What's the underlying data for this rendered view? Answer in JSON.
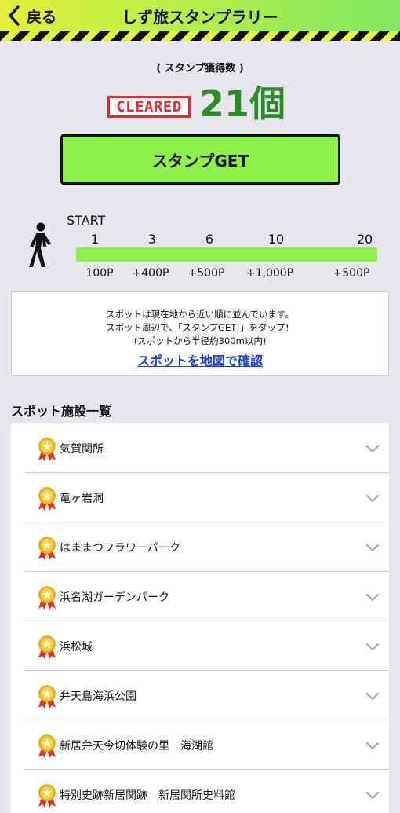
{
  "header": {
    "back_label": "戻る",
    "title": "しず旅スタンプラリー"
  },
  "stamp_count": {
    "caption": "( スタンプ獲得数 )",
    "badge": "CLEARED",
    "value": "21個"
  },
  "stamp_button": {
    "label": "スタンプGET"
  },
  "progress": {
    "start_label": "START",
    "milestones": [
      "1",
      "3",
      "6",
      "10",
      "20"
    ],
    "points": [
      "100P",
      "+400P",
      "+500P",
      "+1,000P",
      "+500P"
    ]
  },
  "info": {
    "line1": "スポットは現在地から近い順に並んでいます。",
    "line2": "スポット周辺で、「スタンプGET!」をタップ！",
    "line3": "(スポットから半径約300m以内)",
    "map_link": "スポットを地図で確認"
  },
  "spots": {
    "title": "スポット施設一覧",
    "items": [
      {
        "label": "気賀関所"
      },
      {
        "label": "竜ヶ岩洞"
      },
      {
        "label": "はままつフラワーパーク"
      },
      {
        "label": "浜名湖ガーデンパーク"
      },
      {
        "label": "浜松城"
      },
      {
        "label": "弁天島海浜公園"
      },
      {
        "label": "新居弁天今切体験の里　海湖館"
      },
      {
        "label": "特別史跡新居関跡　新居関所史料館"
      }
    ]
  },
  "colors": {
    "accent_green": "#8ef04a",
    "count_green": "#2e8a2a",
    "cleared_red": "#e32b2b",
    "link_blue": "#1a3fd8"
  },
  "icons": {
    "back": "chevron-left-icon",
    "walker": "walking-person-icon",
    "medal": "gold-medal-icon",
    "expand": "chevron-down-icon"
  }
}
